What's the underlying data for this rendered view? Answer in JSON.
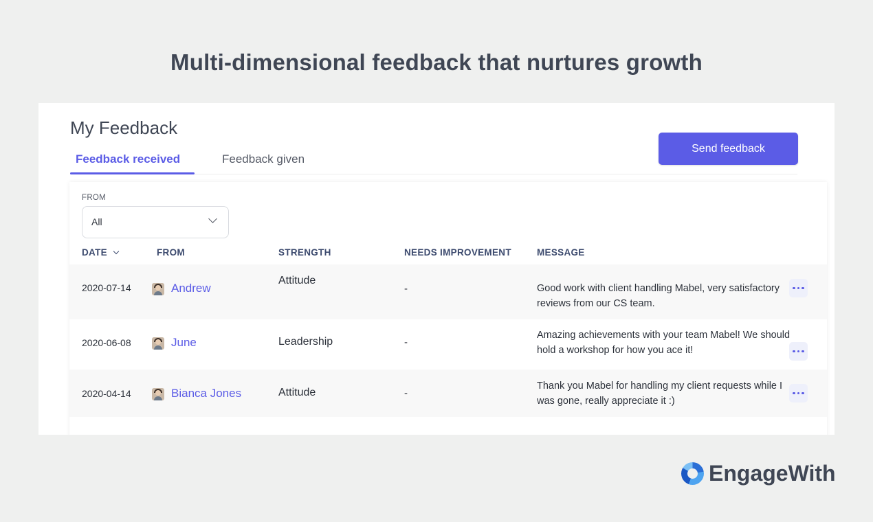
{
  "headline": "Multi-dimensional feedback that nurtures growth",
  "page_title": "My Feedback",
  "tabs": [
    {
      "label": "Feedback received",
      "active": true
    },
    {
      "label": "Feedback given",
      "active": false
    }
  ],
  "send_button_label": "Send feedback",
  "filter": {
    "label": "FROM",
    "value": "All"
  },
  "columns": {
    "date": "DATE",
    "from": "FROM",
    "strength": "STRENGTH",
    "needs_improvement": "NEEDS IMPROVEMENT",
    "message": "MESSAGE"
  },
  "rows": [
    {
      "date": "2020-07-14",
      "from": "Andrew",
      "strength": "Attitude",
      "needs_improvement": "-",
      "message": "Good work with client handling Mabel, very satisfactory reviews from our CS team."
    },
    {
      "date": "2020-06-08",
      "from": "June",
      "strength": "Leadership",
      "needs_improvement": "-",
      "message": "Amazing achievements with your team Mabel! We should hold a workshop for how you ace it!"
    },
    {
      "date": "2020-04-14",
      "from": "Bianca Jones",
      "strength": "Attitude",
      "needs_improvement": "-",
      "message": "Thank you Mabel for handling my client requests while I was gone, really appreciate it :)"
    }
  ],
  "brand": {
    "name": "EngageWith",
    "accent_color": "#5b5ce6"
  }
}
